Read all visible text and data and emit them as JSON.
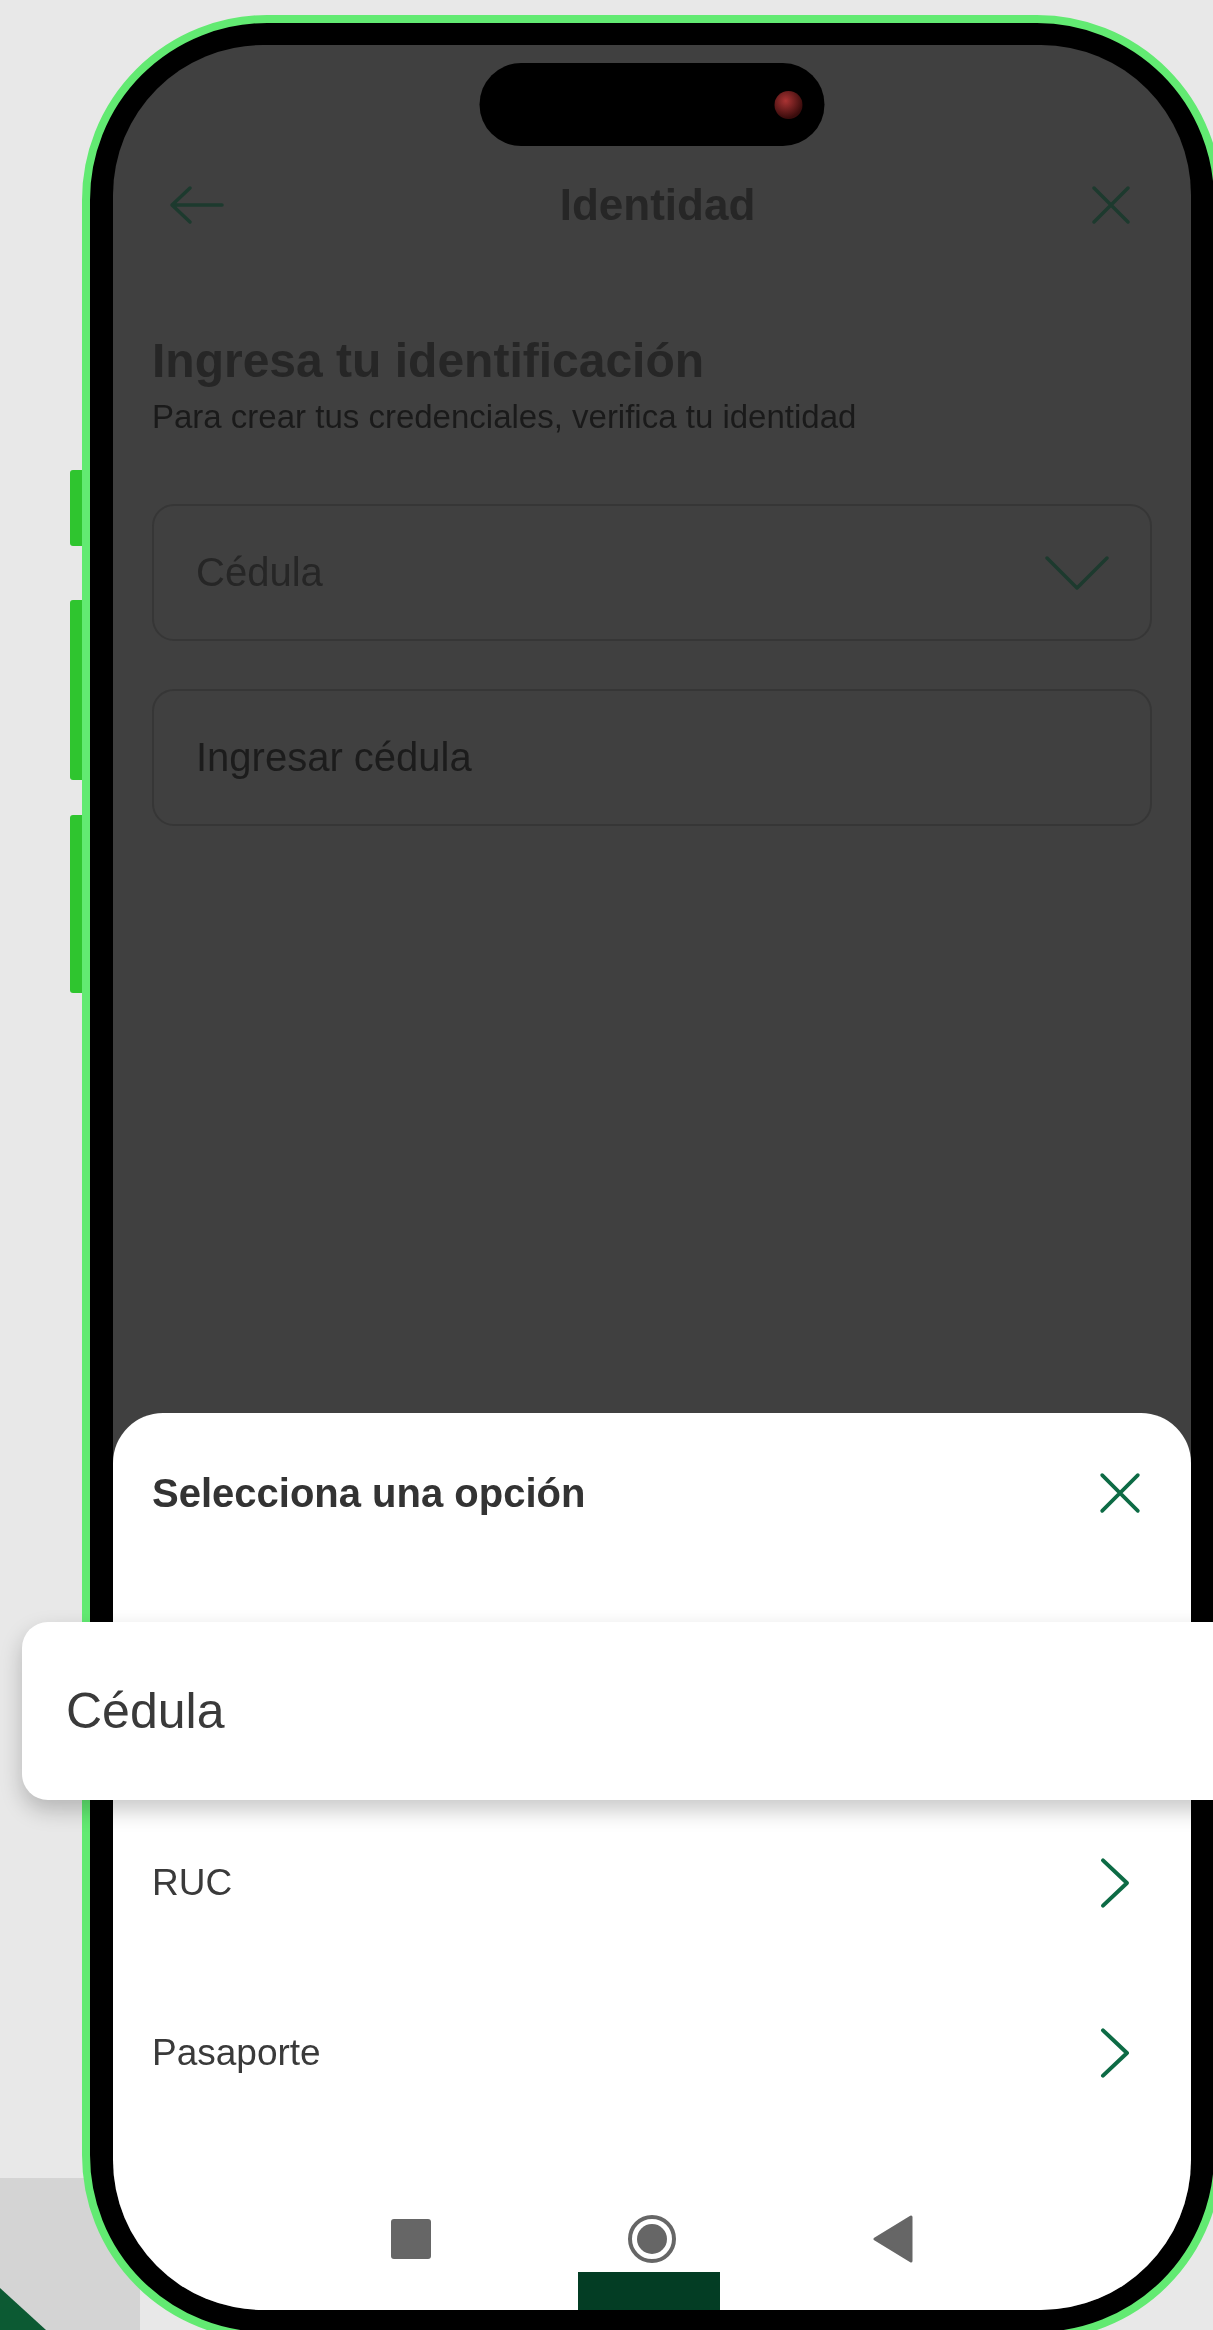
{
  "header": {
    "title": "Identidad"
  },
  "intro": {
    "heading": "Ingresa tu identificación",
    "subtitle": "Para crear tus credenciales, verifica tu identidad"
  },
  "id_type_select": {
    "value": "Cédula"
  },
  "id_number_field": {
    "placeholder": "Ingresar cédula"
  },
  "sheet": {
    "title": "Selecciona una opción",
    "options": [
      {
        "label": "Cédula",
        "selected": true
      },
      {
        "label": "RUC",
        "selected": false
      },
      {
        "label": "Pasaporte",
        "selected": false
      }
    ]
  }
}
